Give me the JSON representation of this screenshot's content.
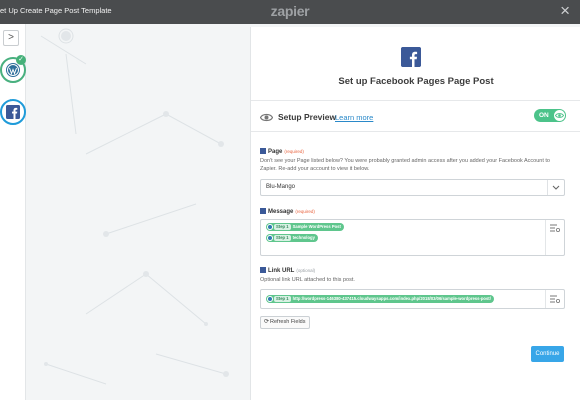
{
  "topbar": {
    "title": "et Up Create Page Post Template",
    "logo": "zapier",
    "close": "×"
  },
  "sidebar": {
    "toggle": ">",
    "steps": [
      {
        "app": "WordPress",
        "status": "complete",
        "icon": "wordpress-icon"
      },
      {
        "app": "Facebook Pages",
        "status": "active",
        "icon": "facebook-icon"
      }
    ],
    "check_icon": "✓"
  },
  "panel": {
    "title": "Set up Facebook Pages Page Post",
    "setup_preview": {
      "label": "Setup Preview",
      "learn_more": "Learn more",
      "toggle": "ON"
    },
    "fields": {
      "page": {
        "label": "Page",
        "tag": "(required)",
        "help": "Don't see your Page listed below? You were probably granted admin access after you added your Facebook Account to Zapier. Re-add your account to view it below.",
        "value": "Blu-Mango"
      },
      "message": {
        "label": "Message",
        "tag": "(required)",
        "tokens": [
          {
            "step": "Step 1",
            "text": "Sample WordPress Post"
          },
          {
            "step": "Step 1",
            "text": "technology"
          }
        ]
      },
      "link_url": {
        "label": "Link URL",
        "tag": "(optional)",
        "help": "Optional link URL attached to this post.",
        "tokens": [
          {
            "step": "Step 1",
            "text": "http://wordpress-146380-437415.cloudwaysapps.com/index.php/2018/03/06/sample-wordpress-post/"
          }
        ]
      }
    },
    "refresh_button": "Refresh Fields",
    "continue_button": "Continue"
  },
  "colors": {
    "topbar": "#4a4c4e",
    "facebook": "#3b5998",
    "token_green": "#5fc68d",
    "toggle_green": "#4cc38a",
    "continue_blue": "#38a6e8"
  }
}
